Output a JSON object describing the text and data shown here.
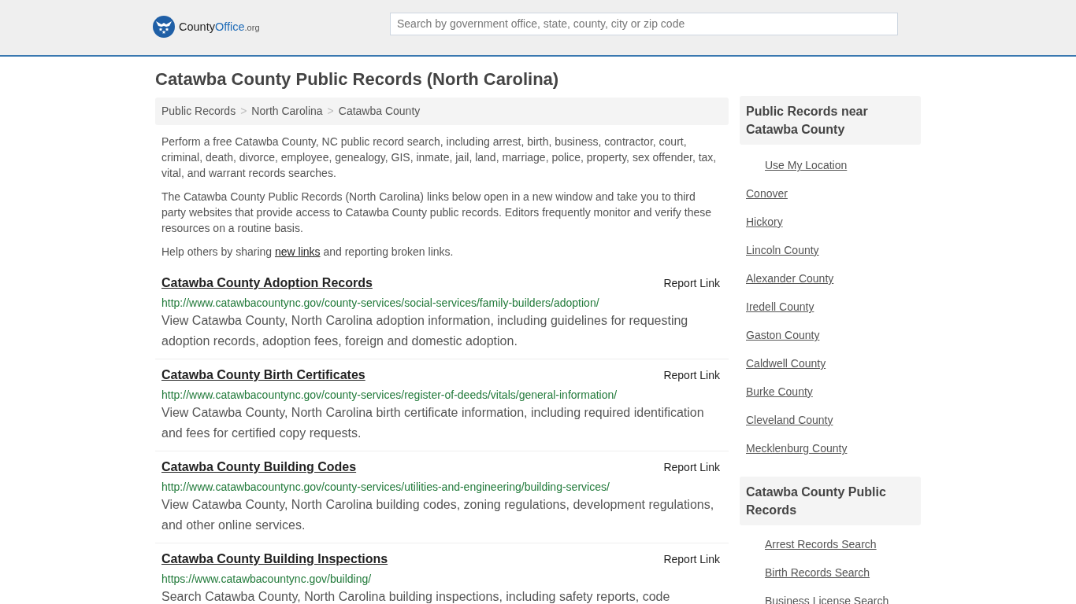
{
  "header": {
    "logo": {
      "part_1": "County",
      "part_2": "Office",
      "part_3": ".org"
    },
    "search": {
      "placeholder": "Search by government office, state, county, city or zip code"
    }
  },
  "page_title": "Catawba County Public Records (North Carolina)",
  "breadcrumb": [
    {
      "label": "Public Records",
      "kind": "link"
    },
    {
      "label": ">",
      "kind": "separator"
    },
    {
      "label": "North Carolina",
      "kind": "link"
    },
    {
      "label": ">",
      "kind": "separator"
    },
    {
      "label": "Catawba County",
      "kind": "link"
    }
  ],
  "intro": [
    {
      "text": "Perform a free Catawba County, NC public record search, including arrest, birth, business, contractor, court, criminal, death, divorce, employee, genealogy, GIS, inmate, jail, land, marriage, police, property, sex offender, tax, vital, and warrant records searches."
    },
    {
      "text": "The Catawba County Public Records (North Carolina) links below open in a new window and take you to third party websites that provide access to Catawba County public records. Editors frequently monitor and verify these resources on a routine basis."
    },
    {
      "text": "Help others by sharing ",
      "link": "new links",
      "after": " and reporting broken links."
    }
  ],
  "records": [
    {
      "title": "Catawba County Adoption Records",
      "report": "Report Link",
      "url": "http://www.catawbacountync.gov/county-services/social-services/family-builders/adoption/",
      "description": "View Catawba County, North Carolina adoption information, including guidelines for requesting adoption records, adoption fees, foreign and domestic adoption."
    },
    {
      "title": "Catawba County Birth Certificates",
      "report": "Report Link",
      "url": "http://www.catawbacountync.gov/county-services/register-of-deeds/vitals/general-information/",
      "description": "View Catawba County, North Carolina birth certificate information, including required identification and fees for certified copy requests."
    },
    {
      "title": "Catawba County Building Codes",
      "report": "Report Link",
      "url": "http://www.catawbacountync.gov/county-services/utilities-and-engineering/building-services/",
      "description": "View Catawba County, North Carolina building codes, zoning regulations, development regulations, and other online services."
    },
    {
      "title": "Catawba County Building Inspections",
      "report": "Report Link",
      "url": "https://www.catawbacountync.gov/building/",
      "description": "Search Catawba County, North Carolina building inspections, including safety reports, code"
    }
  ],
  "sidebar": {
    "sections": [
      {
        "heading": "Public Records near Catawba County",
        "items": [
          {
            "label": "Use My Location",
            "kind": "location"
          },
          {
            "label": "Conover",
            "kind": "place"
          },
          {
            "label": "Hickory",
            "kind": "place"
          },
          {
            "label": "Lincoln County",
            "kind": "place"
          },
          {
            "label": "Alexander County",
            "kind": "place"
          },
          {
            "label": "Iredell County",
            "kind": "place"
          },
          {
            "label": "Gaston County",
            "kind": "place"
          },
          {
            "label": "Caldwell County",
            "kind": "place"
          },
          {
            "label": "Burke County",
            "kind": "place"
          },
          {
            "label": "Cleveland County",
            "kind": "place"
          },
          {
            "label": "Mecklenburg County",
            "kind": "place"
          }
        ]
      },
      {
        "heading": "Catawba County Public Records",
        "items": [
          {
            "label": "Arrest Records Search",
            "kind": "search"
          },
          {
            "label": "Birth Records Search",
            "kind": "search"
          },
          {
            "label": "Business License Search",
            "kind": "search"
          }
        ]
      }
    ]
  }
}
